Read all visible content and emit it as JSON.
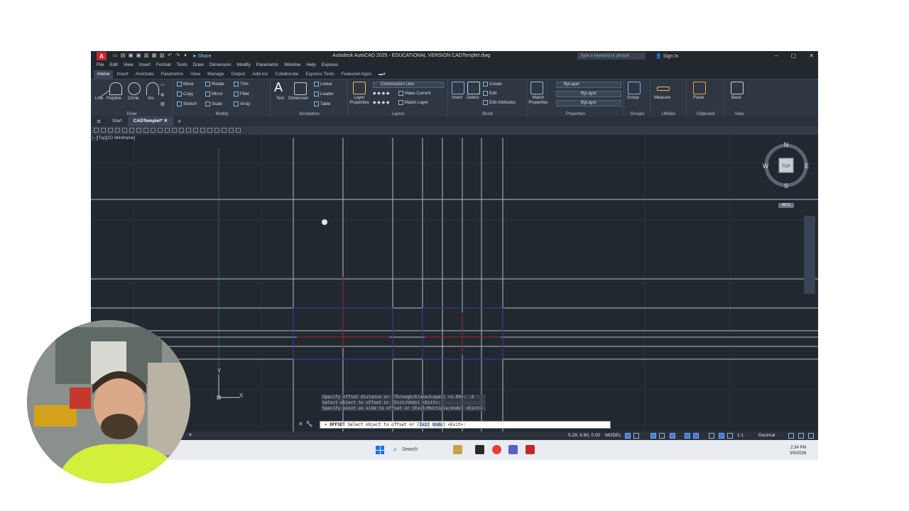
{
  "titlebar": {
    "app_logo": "A",
    "share_label": "Share",
    "title": "Autodesk AutoCAD 2025 - EDUCATIONAL VERSION   CADTemplet.dwg",
    "search_placeholder": "Type a keyword or phrase",
    "signin_label": "Sign In"
  },
  "menu": [
    "File",
    "Edit",
    "View",
    "Insert",
    "Format",
    "Tools",
    "Draw",
    "Dimension",
    "Modify",
    "Parametric",
    "Window",
    "Help",
    "Express"
  ],
  "ribbon_tabs": [
    "Home",
    "Insert",
    "Annotate",
    "Parametric",
    "View",
    "Manage",
    "Output",
    "Add-ins",
    "Collaborate",
    "Express Tools",
    "Featured Apps"
  ],
  "ribbon": {
    "draw": {
      "title": "Draw",
      "line": "Line",
      "polyline": "Polyline",
      "circle": "Circle",
      "arc": "Arc"
    },
    "modify": {
      "title": "Modify",
      "move": "Move",
      "rotate": "Rotate",
      "trim": "Trim",
      "copy": "Copy",
      "mirror": "Mirror",
      "fillet": "Fillet",
      "stretch": "Stretch",
      "scale": "Scale",
      "array": "Array"
    },
    "annotation": {
      "title": "Annotation",
      "text": "Text",
      "dimension": "Dimension",
      "linear": "Linear",
      "leader": "Leader",
      "table": "Table"
    },
    "layers": {
      "title": "Layers",
      "layer_properties": "Layer Properties",
      "current_layer": "Construction Line",
      "make_current": "Make Current",
      "match_layer": "Match Layer"
    },
    "block": {
      "title": "Block",
      "insert": "Insert",
      "detect": "Detect",
      "create": "Create",
      "edit": "Edit",
      "edit_attributes": "Edit Attributes"
    },
    "properties": {
      "title": "Properties",
      "match_properties": "Match Properties",
      "color": "ByLayer",
      "linetype": "ByLayer",
      "lineweight": "ByLayer"
    },
    "groups": {
      "title": "Groups",
      "group": "Group"
    },
    "utilities": {
      "title": "Utilities",
      "measure": "Measure"
    },
    "clipboard": {
      "title": "Clipboard",
      "paste": "Paste"
    },
    "view": {
      "title": "View",
      "base": "Base"
    }
  },
  "file_tabs": {
    "start": "Start",
    "active": "CADTemplet*"
  },
  "viewport": {
    "label": "[−][Top][2D Wireframe]",
    "viewcube": {
      "n": "N",
      "s": "S",
      "e": "E",
      "w": "W",
      "face": "TOP"
    },
    "wcs": "WCS",
    "ucs_x": "X",
    "ucs_y": "Y"
  },
  "command": {
    "history": [
      "Specify offset distance or [Through/Erase/Layer] <1.00>: .4",
      "Select object to offset or [Exit/Undo] <Exit>:",
      "Specify point on side to offset or [Exit/Multiple/Undo] <Exit>:"
    ],
    "current_cmd": "OFFSET",
    "current_prompt_a": "Select object to offset or [",
    "current_opt1": "Exit",
    "current_sep": " ",
    "current_opt2": "Undo",
    "current_prompt_b": "] <Exit>:"
  },
  "status": {
    "coords": "5.29, 8.80, 0.00",
    "mode": "MODEL",
    "units": "Decimal",
    "scale": "1:1"
  },
  "taskbar": {
    "search_label": "Search",
    "time": "2:34 PM",
    "date": "3/5/2026"
  },
  "colors": {
    "accent": "#3f7ad6",
    "canvas": "#212830",
    "ribbon": "#2e3742",
    "logo": "#c8262e"
  }
}
